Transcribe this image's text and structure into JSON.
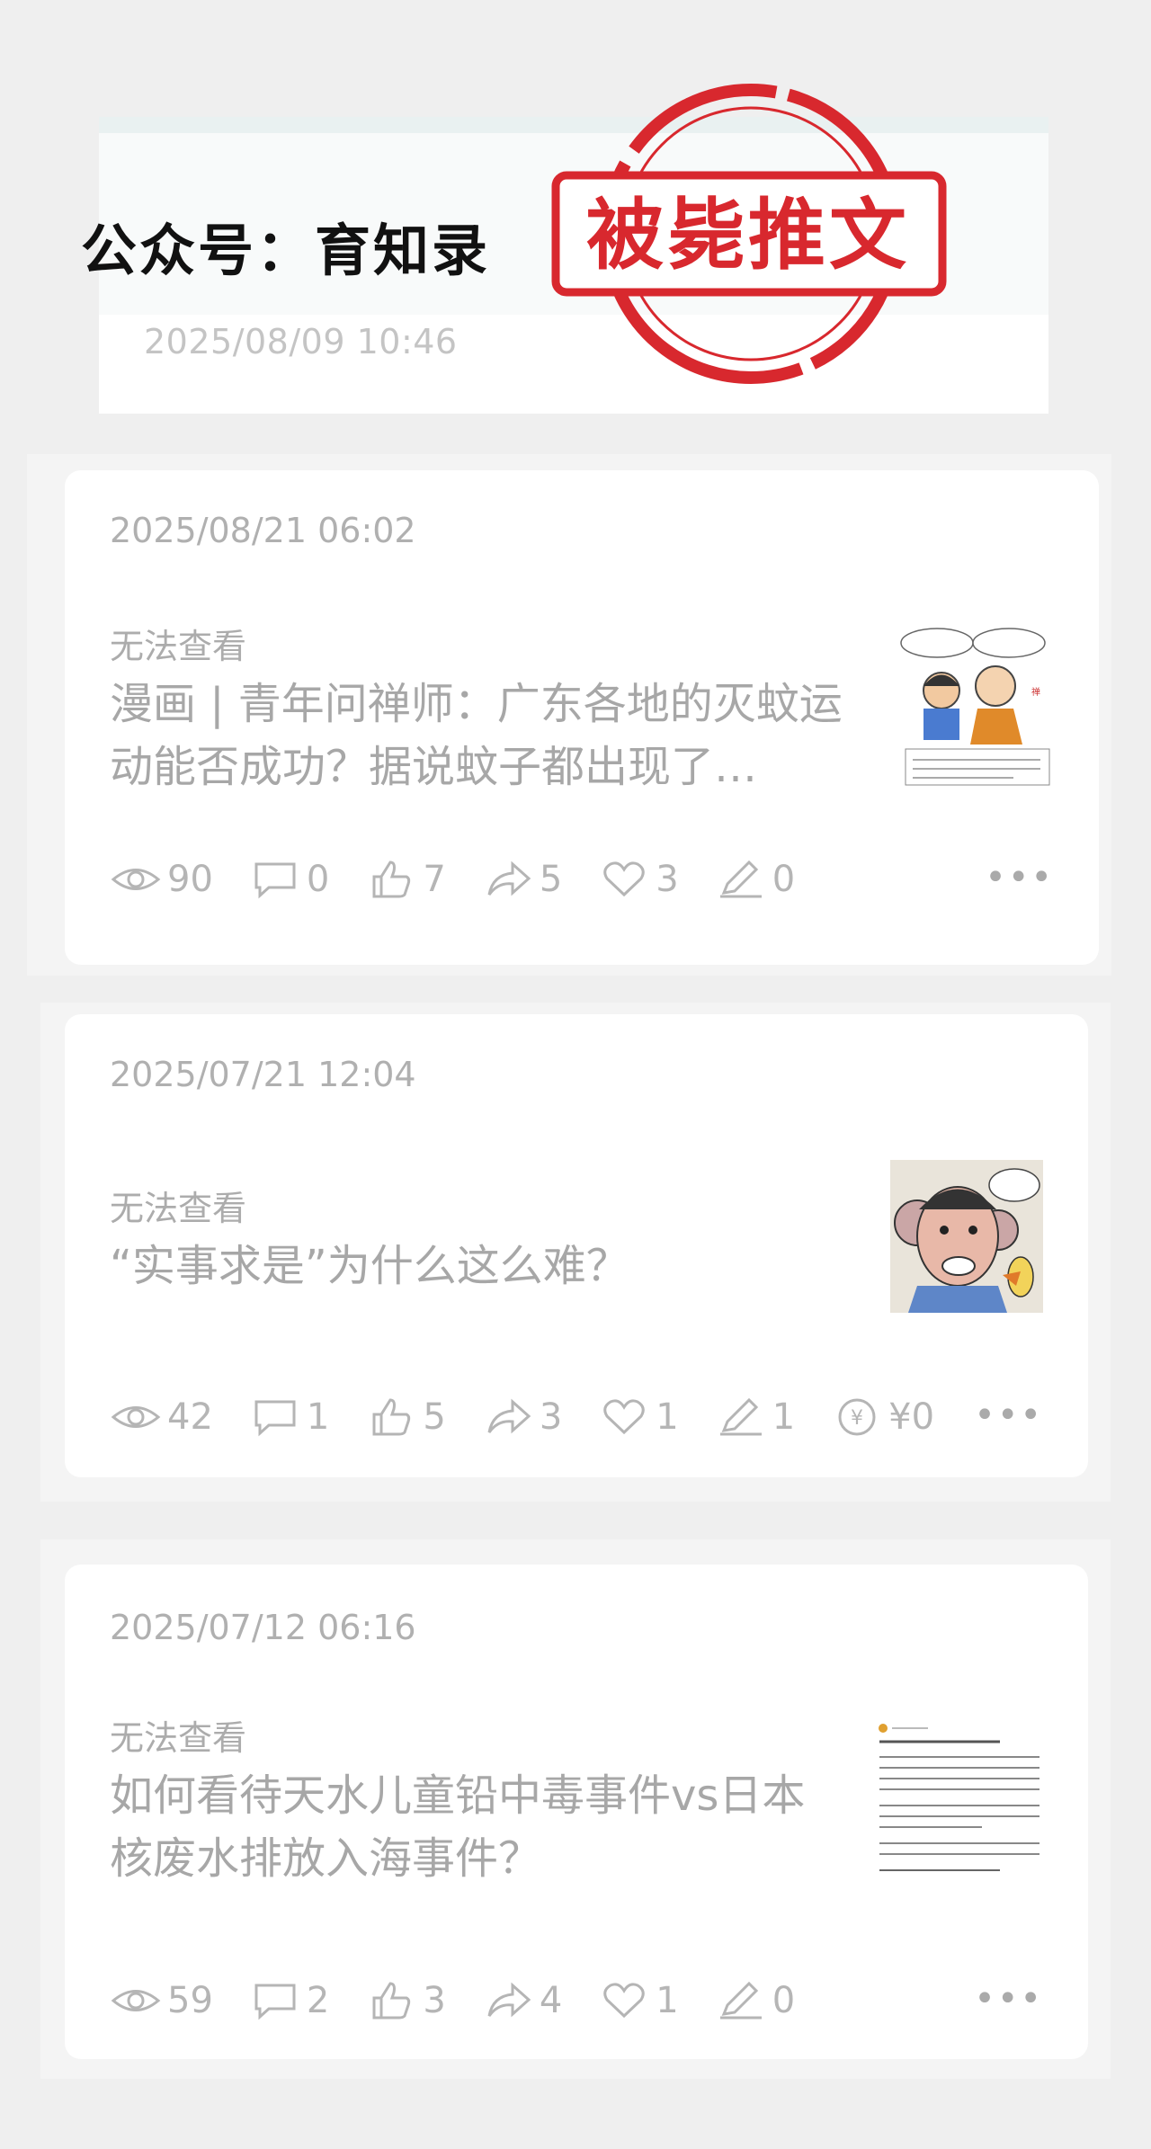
{
  "header": {
    "account_label": "公众号：育知录",
    "stamp_text": "被毙推文",
    "top_date": "2025/08/09 10:46"
  },
  "articles": [
    {
      "date": "2025/08/21 06:02",
      "status": "无法查看",
      "title": "漫画 | 青年问禅师：广东各地的灭蚊运动能否成功？据说蚊子都出现了…",
      "thumbnail": "comic-young-man-and-monk",
      "stats": {
        "views": "90",
        "comments": "0",
        "likes": "7",
        "shares": "5",
        "favorites": "3",
        "notes": "0"
      }
    },
    {
      "date": "2025/07/21 12:04",
      "status": "无法查看",
      "title": "“实事求是”为什么这么难？",
      "thumbnail": "caricature-man-with-duck",
      "stats": {
        "views": "42",
        "comments": "1",
        "likes": "5",
        "shares": "3",
        "favorites": "1",
        "notes": "1",
        "rewards": "¥0"
      }
    },
    {
      "date": "2025/07/12 06:16",
      "status": "无法查看",
      "title": "如何看待天水儿童铅中毒事件vs日本核废水排放入海事件？",
      "thumbnail": "text-screenshot",
      "stats": {
        "views": "59",
        "comments": "2",
        "likes": "3",
        "shares": "4",
        "favorites": "1",
        "notes": "0"
      }
    }
  ],
  "icons": [
    "eye-icon",
    "comment-icon",
    "thumbs-up-icon",
    "share-icon",
    "heart-icon",
    "pen-icon",
    "yen-icon",
    "more-icon"
  ],
  "colors": {
    "stamp": "#d8282e",
    "muted_text": "#a9a9a9",
    "background": "#efefef"
  }
}
